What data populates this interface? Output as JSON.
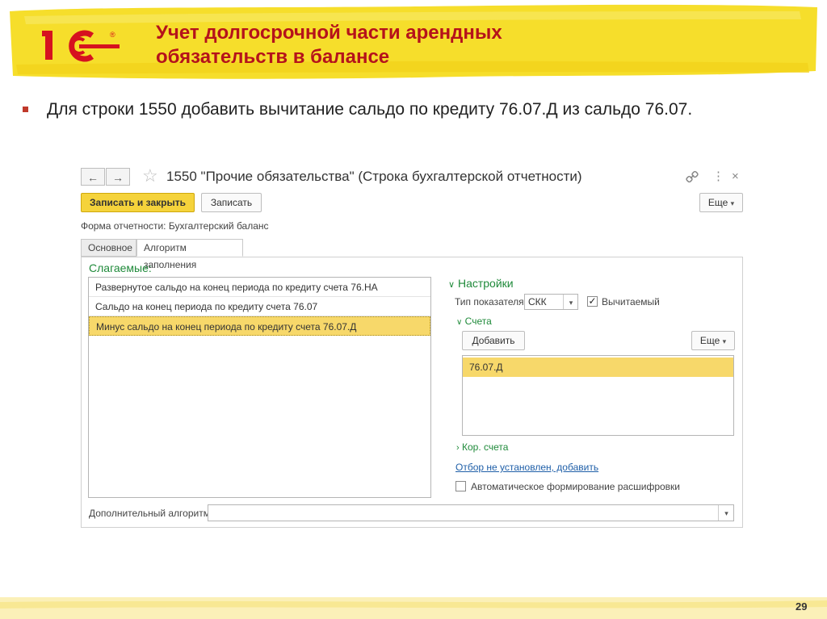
{
  "slide": {
    "title_line1": "Учет долгосрочной части арендных",
    "title_line2": "обязательств в балансе",
    "bullet": "Для строки 1550 добавить вычитание сальдо по кредиту 76.07.Д из сальдо 76.07.",
    "page_number": "29",
    "logo_text": "1С",
    "logo_mark": "®"
  },
  "window": {
    "back_icon": "←",
    "forward_icon": "→",
    "star_icon": "☆",
    "title": "1550 \"Прочие обязательства\" (Строка бухгалтерской отчетности)",
    "link_icon": "🔗",
    "more_icon": "⋮",
    "close_icon": "×"
  },
  "toolbar": {
    "save_close_label": "Записать и закрыть",
    "save_label": "Записать",
    "more_label": "Еще"
  },
  "form": {
    "report_form_label": "Форма отчетности:",
    "report_form_value": "Бухгалтерский баланс"
  },
  "tabs": [
    {
      "label": "Основное"
    },
    {
      "label": "Алгоритм заполнения"
    }
  ],
  "terms": {
    "heading": "Слагаемые:",
    "rows": [
      "Развернутое сальдо на конец периода по кредиту счета 76.НА",
      "Сальдо на конец периода по кредиту счета 76.07",
      "Минус сальдо на конец периода по кредиту счета 76.07.Д"
    ]
  },
  "settings": {
    "heading": "Настройки",
    "indicator_type_label": "Тип показателя:",
    "indicator_type_value": "СКК",
    "subtract_label": "Вычитаемый",
    "subtract_checked": "✓",
    "accounts_heading": "Счета",
    "add_label": "Добавить",
    "more_label": "Еще",
    "accounts": [
      "76.07.Д"
    ],
    "corr_accounts_heading": "Кор. счета",
    "filter_link": "Отбор не установлен, добавить",
    "auto_decode_label": "Автоматическое формирование расшифровки"
  },
  "additional": {
    "label": "Дополнительный алгоритм:"
  },
  "colors": {
    "accent_yellow": "#f5d33b",
    "title_red": "#b5121b",
    "green": "#1f8a3a"
  }
}
